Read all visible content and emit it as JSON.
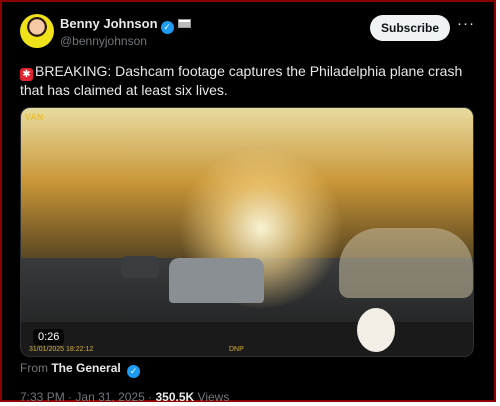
{
  "author": {
    "name": "Benny Johnson",
    "handle": "@bennyjohnson",
    "verified_icon": "verified-badge-icon",
    "flag_icon": "flag-icon"
  },
  "actions": {
    "subscribe_label": "Subscribe",
    "more_label": "···"
  },
  "tweet": {
    "emoji_icon": "police-siren-icon",
    "text": "BREAKING: Dashcam footage captures the Philadelphia plane crash that has claimed at least six lives."
  },
  "video": {
    "duration": "0:26",
    "overlay_corner": "VAN",
    "timestamp_overlay": "31/01/2025 18:22:12",
    "overlay_right": "DNP"
  },
  "source": {
    "prefix": "From",
    "name": "The General"
  },
  "meta": {
    "time": "7:33 PM",
    "separator": "·",
    "date": "Jan 31, 2025",
    "views_count": "350.5K",
    "views_label": "Views"
  },
  "colors": {
    "accent": "#1d9bf0",
    "background": "#000000",
    "text": "#e7e9ea",
    "muted": "#71767b"
  }
}
